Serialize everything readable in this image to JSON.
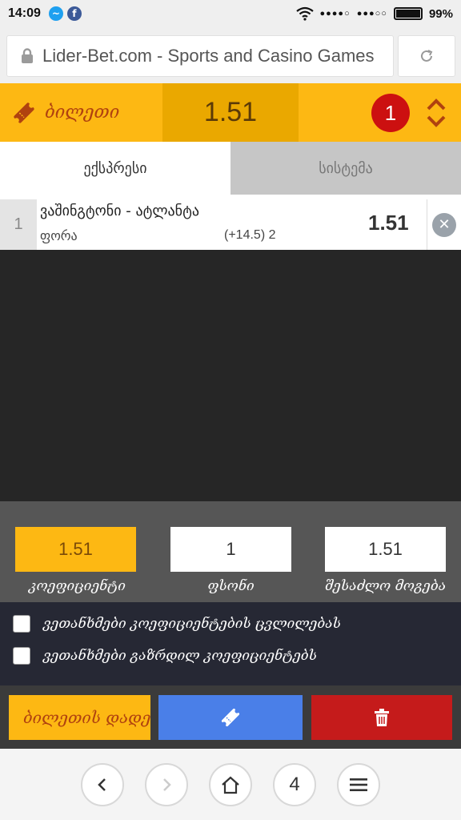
{
  "statusbar": {
    "time": "14:09",
    "battery": "99%",
    "app1_glyph": "~",
    "app2_glyph": "f"
  },
  "browser": {
    "url": "Lider-Bet.com - Sports and Casino Games",
    "tab_count": "4"
  },
  "ticket": {
    "label": "ბილეთი",
    "total_odds": "1.51",
    "count": "1"
  },
  "tabs": [
    {
      "label": "ექსპრესი",
      "active": true
    },
    {
      "label": "სისტემა",
      "active": false
    }
  ],
  "bet": {
    "number": "1",
    "match": "ვაშინგტონი - ატლანტა",
    "market": "ფორა",
    "pick": "(+14.5) 2",
    "odds": "1.51"
  },
  "summary": {
    "odds_value": "1.51",
    "odds_label": "კოეფიციენტი",
    "stake_value": "1",
    "stake_label": "ფსონი",
    "win_value": "1.51",
    "win_label": "შესაძლო მოგება"
  },
  "confirms": {
    "accept_changes": "ვეთანხმები კოეფიციენტების ცვლილებას",
    "accept_increased": "ვეთანხმები გაზრდილ კოეფიციენტებს"
  },
  "actions": {
    "place_label": "ბილეთის დადება"
  },
  "colors": {
    "accent": "#fdb813",
    "danger": "#c51b1b",
    "primary": "#4a7fe8"
  }
}
